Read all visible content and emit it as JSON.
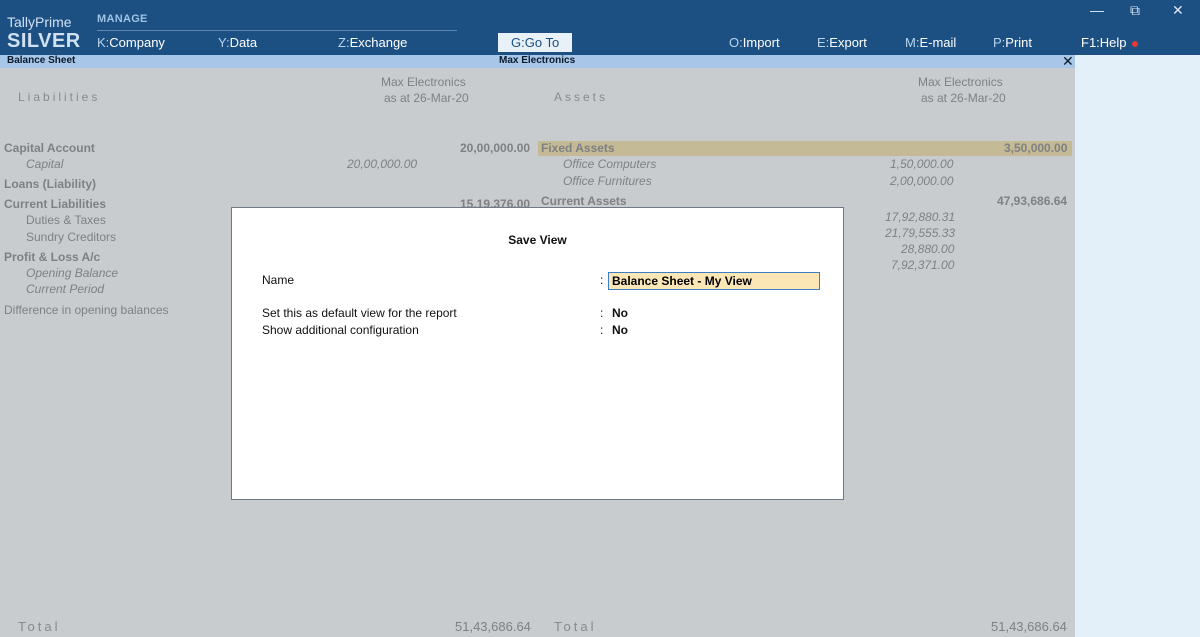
{
  "app": {
    "brand_line1": "TallyPrime",
    "brand_line2": "SILVER",
    "section": "MANAGE"
  },
  "menu": [
    {
      "key": "K",
      "label": "Company"
    },
    {
      "key": "Y",
      "label": "Data"
    },
    {
      "key": "Z",
      "label": "Exchange"
    },
    {
      "key": "G",
      "label": "Go To"
    },
    {
      "key": "O",
      "label": "Import"
    },
    {
      "key": "E",
      "label": "Export"
    },
    {
      "key": "M",
      "label": "E-mail"
    },
    {
      "key": "P",
      "label": "Print"
    },
    {
      "key": "F1",
      "label": "Help"
    }
  ],
  "window_controls": {
    "minimize": "—",
    "restore": "⧉",
    "close": "✕"
  },
  "report_title": {
    "left": "Balance Sheet",
    "center": "Max Electronics",
    "close": "✕"
  },
  "report": {
    "liabilities_header": "Liabilities",
    "assets_header": "Assets",
    "company": "Max Electronics",
    "as_at": "as at 26-Mar-20",
    "liabilities": {
      "capital_account": {
        "label": "Capital Account",
        "total": "20,00,000.00"
      },
      "capital": {
        "label": "Capital",
        "amount": "20,00,000.00"
      },
      "loans": {
        "label": "Loans (Liability)"
      },
      "current_liabilities": {
        "label": "Current Liabilities",
        "total": "15,19,376.00"
      },
      "duties_taxes": {
        "label": "Duties & Taxes"
      },
      "sundry_creditors": {
        "label": "Sundry Creditors"
      },
      "profit_loss": {
        "label": "Profit & Loss A/c"
      },
      "opening_balance": {
        "label": "Opening Balance"
      },
      "current_period": {
        "label": "Current Period"
      },
      "difference": {
        "label": "Difference in opening balances"
      }
    },
    "assets": {
      "fixed_assets": {
        "label": "Fixed Assets",
        "total": "3,50,000.00"
      },
      "office_computers": {
        "label": "Office Computers",
        "amount": "1,50,000.00"
      },
      "office_furnitures": {
        "label": "Office Furnitures",
        "amount": "2,00,000.00"
      },
      "current_assets": {
        "label": "Current Assets",
        "total": "47,93,686.64"
      },
      "ca_amounts": [
        "17,92,880.31",
        "21,79,555.33",
        "28,880.00",
        "7,92,371.00"
      ]
    },
    "total_label": "Total",
    "total_liabilities": "51,43,686.64",
    "total_assets": "51,43,686.64"
  },
  "dialog": {
    "title": "Save View",
    "name_label": "Name",
    "name_value": "Balance Sheet - My View",
    "default_label": "Set this as default view for the report",
    "default_value": "No",
    "config_label": "Show additional configuration",
    "config_value": "No",
    "colon": ":"
  },
  "colors": {
    "topbar": "#1c4f82",
    "titlebar": "#a7c6e8",
    "highlight": "#f3e1a6",
    "input_bg": "#fbe6b6",
    "help_dot": "#e53935"
  }
}
